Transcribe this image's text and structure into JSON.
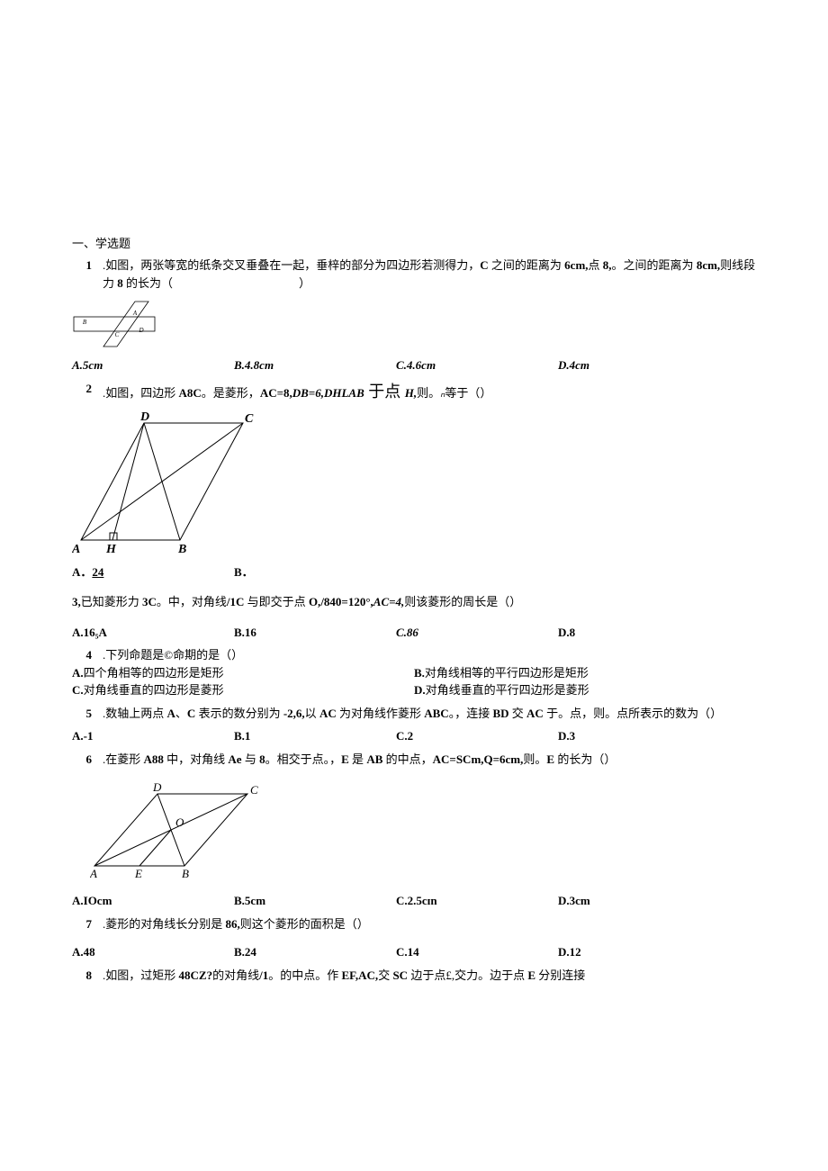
{
  "section_header": "一、学选题",
  "q1": {
    "num": "1",
    "text_1": ".如图，两张等宽的纸条交叉垂叠在一起，垂梓的部分为四边形若测得力，",
    "text_bold_C": "C",
    "text_2": " 之间的距离为 ",
    "dist1": "6cm,",
    "text_3": "点 ",
    "pt8": "8,",
    "text_4": "。之间的距离为 ",
    "dist2": "8cm,",
    "text_5": "则线段力 ",
    "seg8": "8",
    "text_6": " 的长为（",
    "text_7": "）",
    "optA": "A.5cm",
    "optB": "B.4.8cm",
    "optC": "C.4.6cm",
    "optD": "D.4cm"
  },
  "q2": {
    "num": "2",
    "text_1": ".如图，四边形 ",
    "A8C": "A8C",
    "text_2": "。是菱形，",
    "ac": "AC=8,",
    "db": "DB=6,",
    "dhlab": "DHLAB",
    "yudian": " 于点 ",
    "H": "H,",
    "text_3": "则。",
    "n": "ₙ",
    "text_4": "等于（）",
    "labelD": "D",
    "labelC": "C",
    "labelA": "A",
    "labelH": "H",
    "labelB": "B",
    "optA_pre": "A．",
    "optA_val": "24",
    "optB": "B．"
  },
  "q3": {
    "num": "3,",
    "text_1": "已知菱形力 ",
    "3C": "3C",
    "text_2": "。中，对角线",
    "1C": "/1C",
    "text_3": " 与即交于点 ",
    "O": "O,",
    "ang": "/840=120°,",
    "ac": "AC=4,",
    "text_4": "则该菱形的周长是（）",
    "optA": "A.16₅A",
    "optB": "B.16",
    "optC": "C.86",
    "optD": "D.8"
  },
  "q4": {
    "num": "4",
    "text_1": ".下列命题是©命期的是（）",
    "optA_l": "A.",
    "optA_t": "四个角相等的四边形是矩形",
    "optB_l": "B.",
    "optB_t": "对角线相等的平行四边形是矩形",
    "optC_l": "C.",
    "optC_t": "对角线垂直的四边形是菱形",
    "optD_l": "D.",
    "optD_t": "对角线垂直的平行四边形是菱形"
  },
  "q5": {
    "num": "5",
    "text_1": ".数轴上两点 ",
    "A": "A",
    "text_2": "、",
    "C": "C",
    "text_3": " 表示的数分别为 ",
    "vals": "-2,6,",
    "text_4": "以 ",
    "AC": "AC",
    "text_5": " 为对角线作菱形 ",
    "ABC": "ABC",
    "text_6": "。，连接 ",
    "BD": "BD",
    "text_7": " 交 ",
    "AC2": "AC",
    "text_8": " 于。点，则。点所表示的数为（）",
    "optA": "A.-1",
    "optB": "B.1",
    "optC": "C.2",
    "optD": "D.3"
  },
  "q6": {
    "num": "6",
    "text_1": ".在菱形 ",
    "A88": "A88",
    "text_2": " 中，对角线 ",
    "Ae": "Ae",
    "text_3": " 与 ",
    "8": "8",
    "text_4": "。相交于点。，",
    "E": "E",
    "text_5": " 是 ",
    "AB": "AB",
    "text_6": " 的中点，",
    "AC": "AC=SCm,Q=6cm,",
    "text_7": "则。",
    "E2": "E",
    "text_8": " 的长为（）",
    "labelD": "D",
    "labelC": "C",
    "labelO": "O",
    "labelA": "A",
    "labelE": "E",
    "labelB": "B",
    "optA": "A.IOcm",
    "optB": "B.5cm",
    "optC": "C.2.5cɪn",
    "optD": "D.3cm"
  },
  "q7": {
    "num": "7",
    "text_1": ".菱形的对角线长分别是 ",
    "vals": "86,",
    "text_2": "则这个菱形的面积是（）",
    "optA": "A.48",
    "optB": "B.24",
    "optC": "C.14",
    "optD": "D.12"
  },
  "q8": {
    "num": "8",
    "text_1": ".如图，过矩形 ",
    "rect": "48CZ?",
    "text_2": "的对角线",
    "diag": "/1",
    "text_3": "。的中点。作 ",
    "EFAC": "EF,AC,",
    "text_4": "交 ",
    "SC": "SC",
    "text_5": " 边于点£,交力。边于点 ",
    "E": "E",
    "text_6": " 分别连接"
  }
}
